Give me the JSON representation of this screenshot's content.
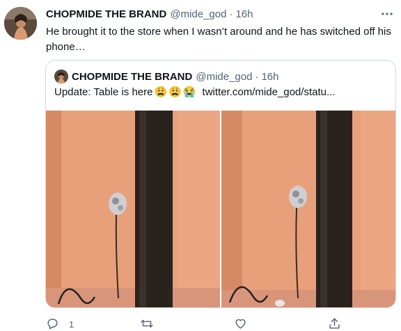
{
  "tweet": {
    "author_name": "CHOPMIDE THE BRAND",
    "handle": "@mide_god",
    "separator": "·",
    "time": "16h",
    "text": "He brought it to the store when I wasn’t around and he has switched off his phone…"
  },
  "quoted": {
    "author_name": "CHOPMIDE THE BRAND",
    "handle": "@mide_god",
    "separator": "·",
    "time": "16h",
    "text": "Update: Table is here",
    "emojis": [
      "😩",
      "😩",
      "😭"
    ],
    "link": "twitter.com/mide_god/statu..."
  },
  "actions": {
    "reply_count": "1",
    "icons": [
      "reply-icon",
      "retweet-icon",
      "like-icon",
      "share-icon"
    ]
  },
  "colors": {
    "text": "#0f1419",
    "secondary": "#536471",
    "border": "#cfd9de",
    "wall": "#e8a07a",
    "pole": "#2a221d"
  }
}
